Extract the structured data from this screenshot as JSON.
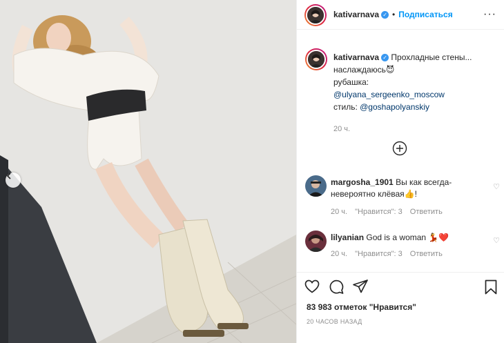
{
  "header": {
    "username": "kativarnava",
    "separator": "•",
    "follow_label": "Подписаться",
    "more_label": "···"
  },
  "caption": {
    "username": "kativarnava",
    "line1": "Прохладные стены...",
    "line2": "наслаждаюсь😈",
    "line3": "рубашка:",
    "mention1": "@ulyana_sergeenko_moscow",
    "line5_prefix": "стиль: ",
    "mention2": "@goshapolyanskiy",
    "time": "20 ч."
  },
  "load_more_icon": "plus-circle-icon",
  "comments": [
    {
      "username": "margosha_1901",
      "text": "Вы как всегда-невероятно клёвая👍!",
      "time": "20 ч.",
      "likes": "\"Нравится\": 3",
      "reply": "Ответить"
    },
    {
      "username": "lilyanian",
      "text": "God is a woman 💃❤️",
      "time": "20 ч.",
      "likes": "\"Нравится\": 3",
      "reply": "Ответить"
    }
  ],
  "actions": {
    "likes_count": "83 983 отметок \"Нравится\"",
    "posted_ago": "20 ЧАСОВ НАЗАД"
  },
  "colors": {
    "accent": "#0095f6",
    "mention": "#00376b",
    "muted": "#8e8e8e",
    "border": "#efefef"
  }
}
